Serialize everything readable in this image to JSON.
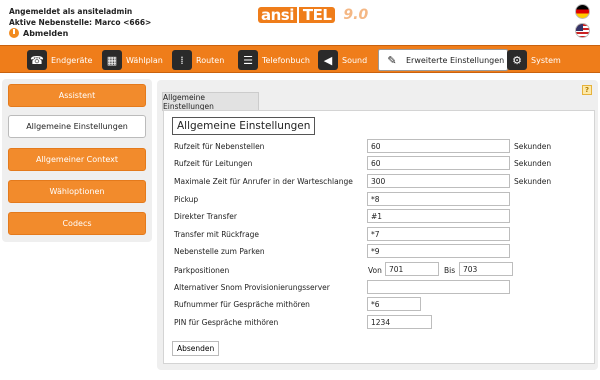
{
  "header": {
    "logged_in_as": "Angemeldet als ansiteladmin",
    "active_extension": "Aktive Nebenstelle: Marco <666>",
    "logout_label": "Abmelden",
    "logo_part1": "ansi",
    "logo_part2": "TEL",
    "logo_version": "9.0"
  },
  "nav": {
    "items": [
      {
        "label": "Endgeräte",
        "icon": "phone-icon"
      },
      {
        "label": "Wählplan",
        "icon": "dialplan-icon"
      },
      {
        "label": "Routen",
        "icon": "routes-icon"
      },
      {
        "label": "Telefonbuch",
        "icon": "phonebook-icon"
      },
      {
        "label": "Sound",
        "icon": "speaker-icon"
      },
      {
        "label": "Erweiterte Einstellungen",
        "icon": "wrench-icon",
        "active": true
      },
      {
        "label": "System",
        "icon": "gear-icon"
      }
    ]
  },
  "sidebar": {
    "items": [
      {
        "label": "Assistent"
      },
      {
        "label": "Allgemeine Einstellungen",
        "active": true
      },
      {
        "label": "Allgemeiner Context"
      },
      {
        "label": "Wähloptionen"
      },
      {
        "label": "Codecs"
      }
    ]
  },
  "main": {
    "tab_label": "Allgemeine Einstellungen",
    "help_label": "?",
    "form_title": "Allgemeine Einstellungen",
    "fields": {
      "ring_ext": {
        "label": "Rufzeit für Nebenstellen",
        "value": "60",
        "unit": "Sekunden"
      },
      "ring_lines": {
        "label": "Rufzeit für Leitungen",
        "value": "60",
        "unit": "Sekunden"
      },
      "queue_max": {
        "label": "Maximale Zeit für Anrufer in der Warteschlange",
        "value": "300",
        "unit": "Sekunden"
      },
      "pickup": {
        "label": "Pickup",
        "value": "*8"
      },
      "direct_transfer": {
        "label": "Direkter Transfer",
        "value": "#1"
      },
      "attended_transfer": {
        "label": "Transfer mit Rückfrage",
        "value": "*7"
      },
      "park_ext": {
        "label": "Nebenstelle zum Parken",
        "value": "*9"
      },
      "park_positions": {
        "label": "Parkpositionen",
        "from_label": "Von",
        "from_value": "701",
        "to_label": "Bis",
        "to_value": "703"
      },
      "snom_server": {
        "label": "Alternativer Snom Provisionierungsserver",
        "value": ""
      },
      "listen_number": {
        "label": "Rufnummer für Gespräche mithören",
        "value": "*6"
      },
      "listen_pin": {
        "label": "PIN für Gespräche mithören",
        "value": "1234"
      }
    },
    "submit_label": "Absenden"
  },
  "colors": {
    "accent": "#ef7d1a",
    "panel": "#efefef"
  }
}
